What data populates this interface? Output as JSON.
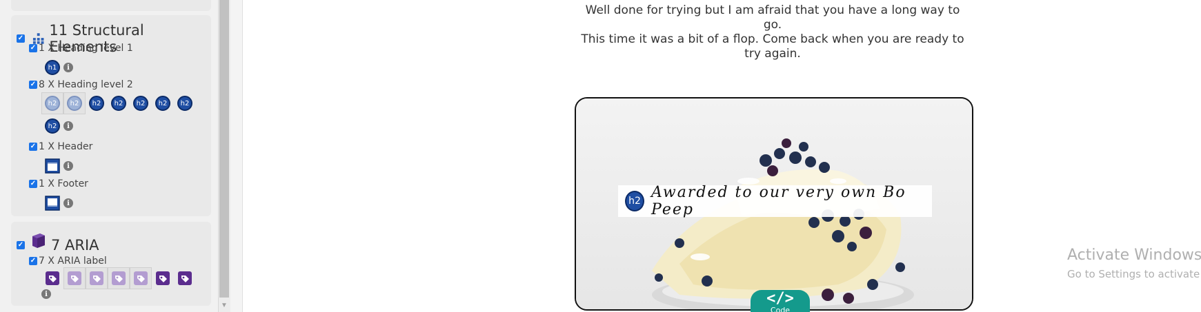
{
  "sidebar": {
    "structural": {
      "title": "11 Structural Elements",
      "items": [
        {
          "label": "1 X Heading level 1",
          "badge": "h1"
        },
        {
          "label": "8 X Heading level 2",
          "badge": "h2"
        },
        {
          "label": "1 X Header"
        },
        {
          "label": "1 X Footer"
        }
      ]
    },
    "aria": {
      "title": "7 ARIA",
      "items": [
        {
          "label": "7 X ARIA label"
        }
      ]
    }
  },
  "main": {
    "message_line1": "Well done for trying but I am afraid that you have a long way to go.",
    "message_line2": "This time it was a bit of a flop. Come back when you are ready to try again.",
    "image_heading_badge": "h2",
    "image_heading": "Awarded to our very own Bo Peep",
    "code_glyph": "</>",
    "code_label": "Code"
  },
  "watermark": {
    "title": "Activate Windows",
    "subtitle": "Go to Settings to activate Windows."
  },
  "colors": {
    "badge_blue": "#1f4ea3",
    "aria_purple": "#5b2d8e",
    "code_teal": "#149a8c",
    "checkbox_blue": "#1a73e8"
  },
  "icons": {
    "structural": "sitemap-icon",
    "aria": "aria-cube-icon",
    "header": "header-landmark-icon",
    "footer": "footer-landmark-icon",
    "aria_label": "tag-icon",
    "info": "info-icon"
  }
}
